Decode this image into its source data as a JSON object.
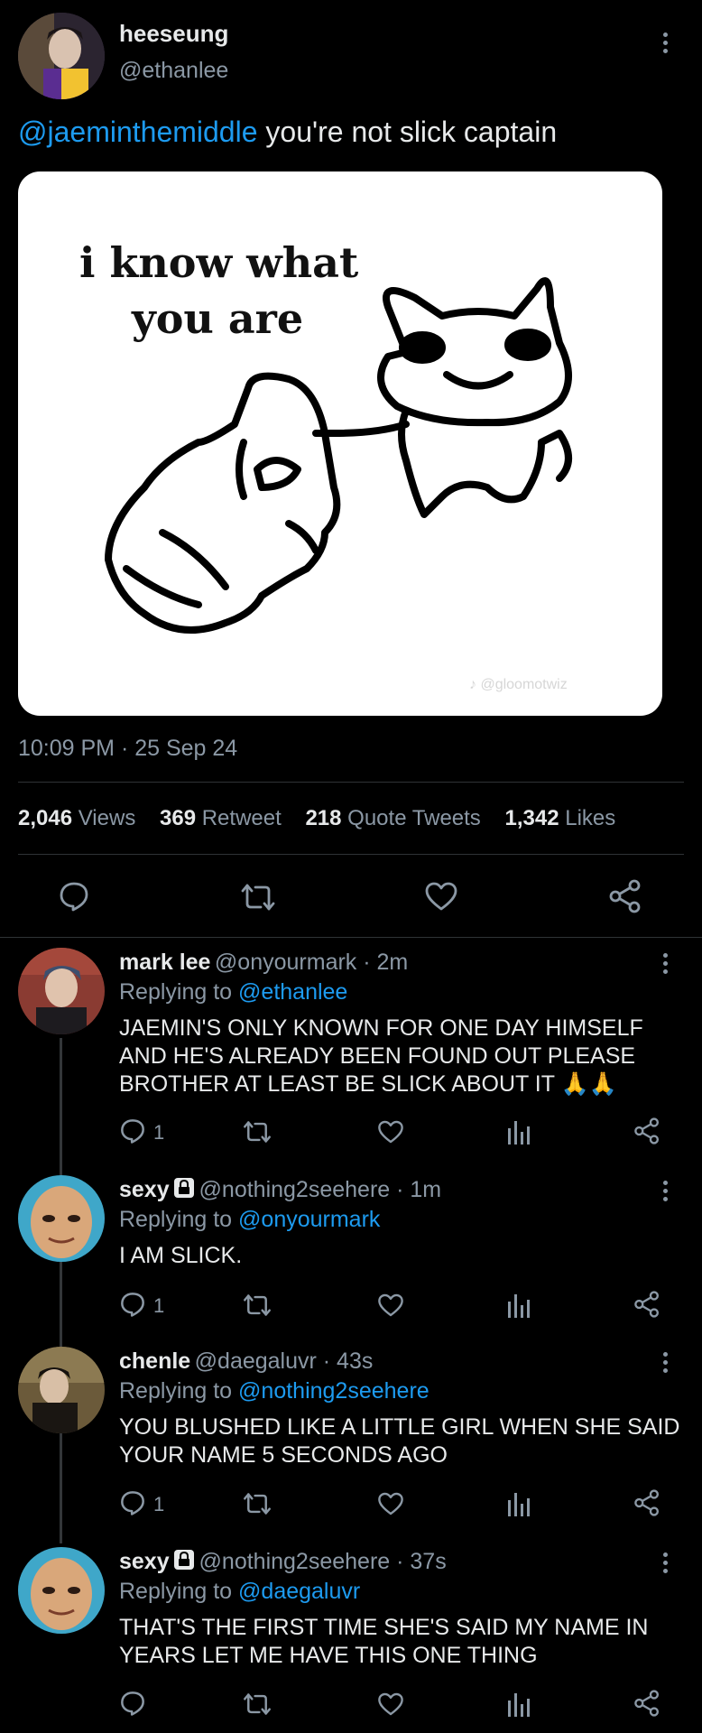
{
  "tweet": {
    "author_name": "heeseung",
    "author_handle": "@ethanlee",
    "mention": "@jaeminthemiddle",
    "text": " you're not slick captain",
    "image": {
      "caption_line1": "i know what",
      "caption_line2": "you are",
      "watermark": "♪ @gloomotwiz"
    },
    "timestamp": "10:09 PM · 25 Sep 24",
    "stats": {
      "views_count": "2,046",
      "views_label": "Views",
      "retweets_count": "369",
      "retweets_label": "Retweet",
      "quotes_count": "218",
      "quotes_label": "Quote Tweets",
      "likes_count": "1,342",
      "likes_label": "Likes"
    }
  },
  "replies": [
    {
      "name": "mark lee",
      "handle_time": "@onyourmark · 2m",
      "replying_label": "Replying to ",
      "replying_to": "@ethanlee",
      "line1": "JAEMIN'S ONLY KNOWN FOR ONE DAY HIMSELF",
      "line2": "AND HE'S ALREADY BEEN FOUND OUT PLEASE",
      "line3": "BROTHER AT LEAST BE SLICK ABOUT IT 🙏🙏",
      "reply_count": "1"
    },
    {
      "name": "sexy",
      "handle_time": "@nothing2seehere · 1m",
      "replying_label": "Replying to ",
      "replying_to": "@onyourmark",
      "line1": "I AM SLICK.",
      "reply_count": "1"
    },
    {
      "name": "chenle",
      "handle_time": "@daegaluvr · 43s",
      "replying_label": "Replying to ",
      "replying_to": "@nothing2seehere",
      "line1": "YOU BLUSHED LIKE A LITTLE GIRL WHEN SHE SAID",
      "line2": "YOUR NAME 5 SECONDS AGO",
      "reply_count": "1"
    },
    {
      "name": "sexy",
      "handle_time": "@nothing2seehere · 37s",
      "replying_label": "Replying to ",
      "replying_to": "@daegaluvr",
      "line1": "THAT'S THE FIRST TIME SHE'S SAID MY NAME IN",
      "line2": "YEARS LET ME HAVE THIS ONE THING",
      "reply_count": ""
    }
  ],
  "colors": {
    "accent": "#1d9bf0",
    "muted": "#8b98a5",
    "background": "#000000",
    "divider": "#2f3336"
  }
}
